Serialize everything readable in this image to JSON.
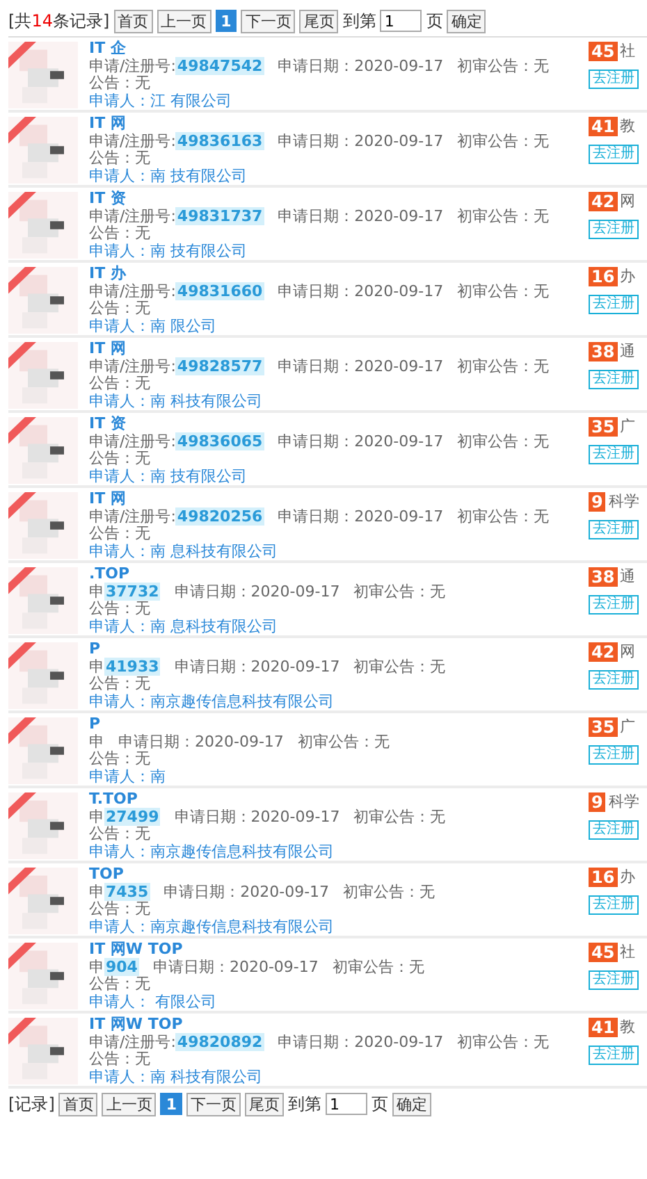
{
  "pager_top": {
    "prefix": "[共",
    "count": "14",
    "suffix": "条记录]",
    "buttons": [
      {
        "label": "首页",
        "kind": "nav",
        "selected": false
      },
      {
        "label": "上一页",
        "kind": "nav",
        "selected": false
      },
      {
        "label": "1",
        "kind": "page",
        "selected": true
      },
      {
        "label": "下一页",
        "kind": "nav",
        "selected": false
      },
      {
        "label": "尾页",
        "kind": "nav",
        "selected": false
      }
    ],
    "goto_label": "到第",
    "page_value": "1",
    "page_unit": "页",
    "confirm": "确定"
  },
  "records": [
    {
      "title": "IT 企",
      "reg_label": "申请/注册号:",
      "reg_no": "49847542",
      "date": "申请日期：2020-09-17",
      "notice": "初审公告：无",
      "announce": "公告：无",
      "applicant": "申请人：江 有限公司",
      "badge": "45",
      "category": "社",
      "action": "去注册"
    },
    {
      "title": "IT 网",
      "reg_label": "申请/注册号:",
      "reg_no": "49836163",
      "date": "申请日期：2020-09-17",
      "notice": "初审公告：无",
      "announce": "公告：无",
      "applicant": "申请人：南 技有限公司",
      "badge": "41",
      "category": "教",
      "action": "去注册"
    },
    {
      "title": "IT 资",
      "reg_label": "申请/注册号:",
      "reg_no": "49831737",
      "date": "申请日期：2020-09-17",
      "notice": "初审公告：无",
      "announce": "公告：无",
      "applicant": "申请人：南 技有限公司",
      "badge": "42",
      "category": "网",
      "action": "去注册"
    },
    {
      "title": "IT 办",
      "reg_label": "申请/注册号:",
      "reg_no": "49831660",
      "date": "申请日期：2020-09-17",
      "notice": "初审公告：无",
      "announce": "公告：无",
      "applicant": "申请人：南 限公司",
      "badge": "16",
      "category": "办",
      "action": "去注册"
    },
    {
      "title": "IT 网",
      "reg_label": "申请/注册号:",
      "reg_no": "49828577",
      "date": "申请日期：2020-09-17",
      "notice": "初审公告：无",
      "announce": "公告：无",
      "applicant": "申请人：南 科技有限公司",
      "badge": "38",
      "category": "通",
      "action": "去注册"
    },
    {
      "title": "IT 资",
      "reg_label": "申请/注册号:",
      "reg_no": "49836065",
      "date": "申请日期：2020-09-17",
      "notice": "初审公告：无",
      "announce": "公告：无",
      "applicant": "申请人：南 技有限公司",
      "badge": "35",
      "category": "广",
      "action": "去注册"
    },
    {
      "title": "IT 网",
      "reg_label": "申请/注册号:",
      "reg_no": "49820256",
      "date": "申请日期：2020-09-17",
      "notice": "初审公告：无",
      "announce": "公告：无",
      "applicant": "申请人：南 息科技有限公司",
      "badge": "9",
      "category": "科学",
      "action": "去注册"
    },
    {
      "title": ".TOP",
      "reg_label": "申",
      "reg_no": "37732",
      "date": "申请日期：2020-09-17",
      "notice": "初审公告：无",
      "announce": "公告：无",
      "applicant": "申请人：南 息科技有限公司",
      "badge": "38",
      "category": "通",
      "action": "去注册"
    },
    {
      "title": "P",
      "reg_label": "申",
      "reg_no": "41933",
      "date": "申请日期：2020-09-17",
      "notice": "初审公告：无",
      "announce": "公告：无",
      "applicant": "申请人：南京趣传信息科技有限公司",
      "badge": "42",
      "category": "网",
      "action": "去注册"
    },
    {
      "title": "P",
      "reg_label": "申",
      "date": "申请日期：2020-09-17",
      "notice": "初审公告：无",
      "announce": "公告：无",
      "applicant": "申请人：南",
      "badge": "35",
      "category": "广",
      "action": "去注册"
    },
    {
      "title": "T.TOP",
      "reg_label": "申",
      "reg_no": "27499",
      "date": "申请日期：2020-09-17",
      "notice": "初审公告：无",
      "announce": "公告：无",
      "applicant": "申请人：南京趣传信息科技有限公司",
      "badge": "9",
      "category": "科学",
      "action": "去注册"
    },
    {
      "title": "TOP",
      "reg_label": "申",
      "reg_no": "7435",
      "date": "申请日期：2020-09-17",
      "notice": "初审公告：无",
      "announce": "公告：无",
      "applicant": "申请人：南京趣传信息科技有限公司",
      "badge": "16",
      "category": "办",
      "action": "去注册"
    },
    {
      "title": "IT 网W TOP",
      "reg_label": "申",
      "reg_no": "904",
      "date": "申请日期：2020-09-17",
      "notice": "初审公告：无",
      "announce": "公告：无",
      "applicant": "申请人： 有限公司",
      "badge": "45",
      "category": "社",
      "action": "去注册"
    },
    {
      "title": "IT 网W TOP",
      "reg_label": "申请/注册号:",
      "reg_no": "49820892",
      "date": "申请日期：2020-09-17",
      "notice": "初审公告：无",
      "announce": "公告：无",
      "applicant": "申请人：南 科技有限公司",
      "badge": "41",
      "category": "教",
      "action": "去注册"
    }
  ],
  "pager_bottom": {
    "prefix": "[",
    "suffix": "记录]",
    "buttons": [
      {
        "label": "首页",
        "kind": "nav",
        "selected": false
      },
      {
        "label": "上一页",
        "kind": "nav",
        "selected": false
      },
      {
        "label": "1",
        "kind": "page",
        "selected": true
      },
      {
        "label": "下一页",
        "kind": "nav",
        "selected": false
      },
      {
        "label": "尾页",
        "kind": "nav",
        "selected": false
      }
    ],
    "goto_label": "到第",
    "page_value": "1",
    "page_unit": "页",
    "confirm": "确定"
  }
}
